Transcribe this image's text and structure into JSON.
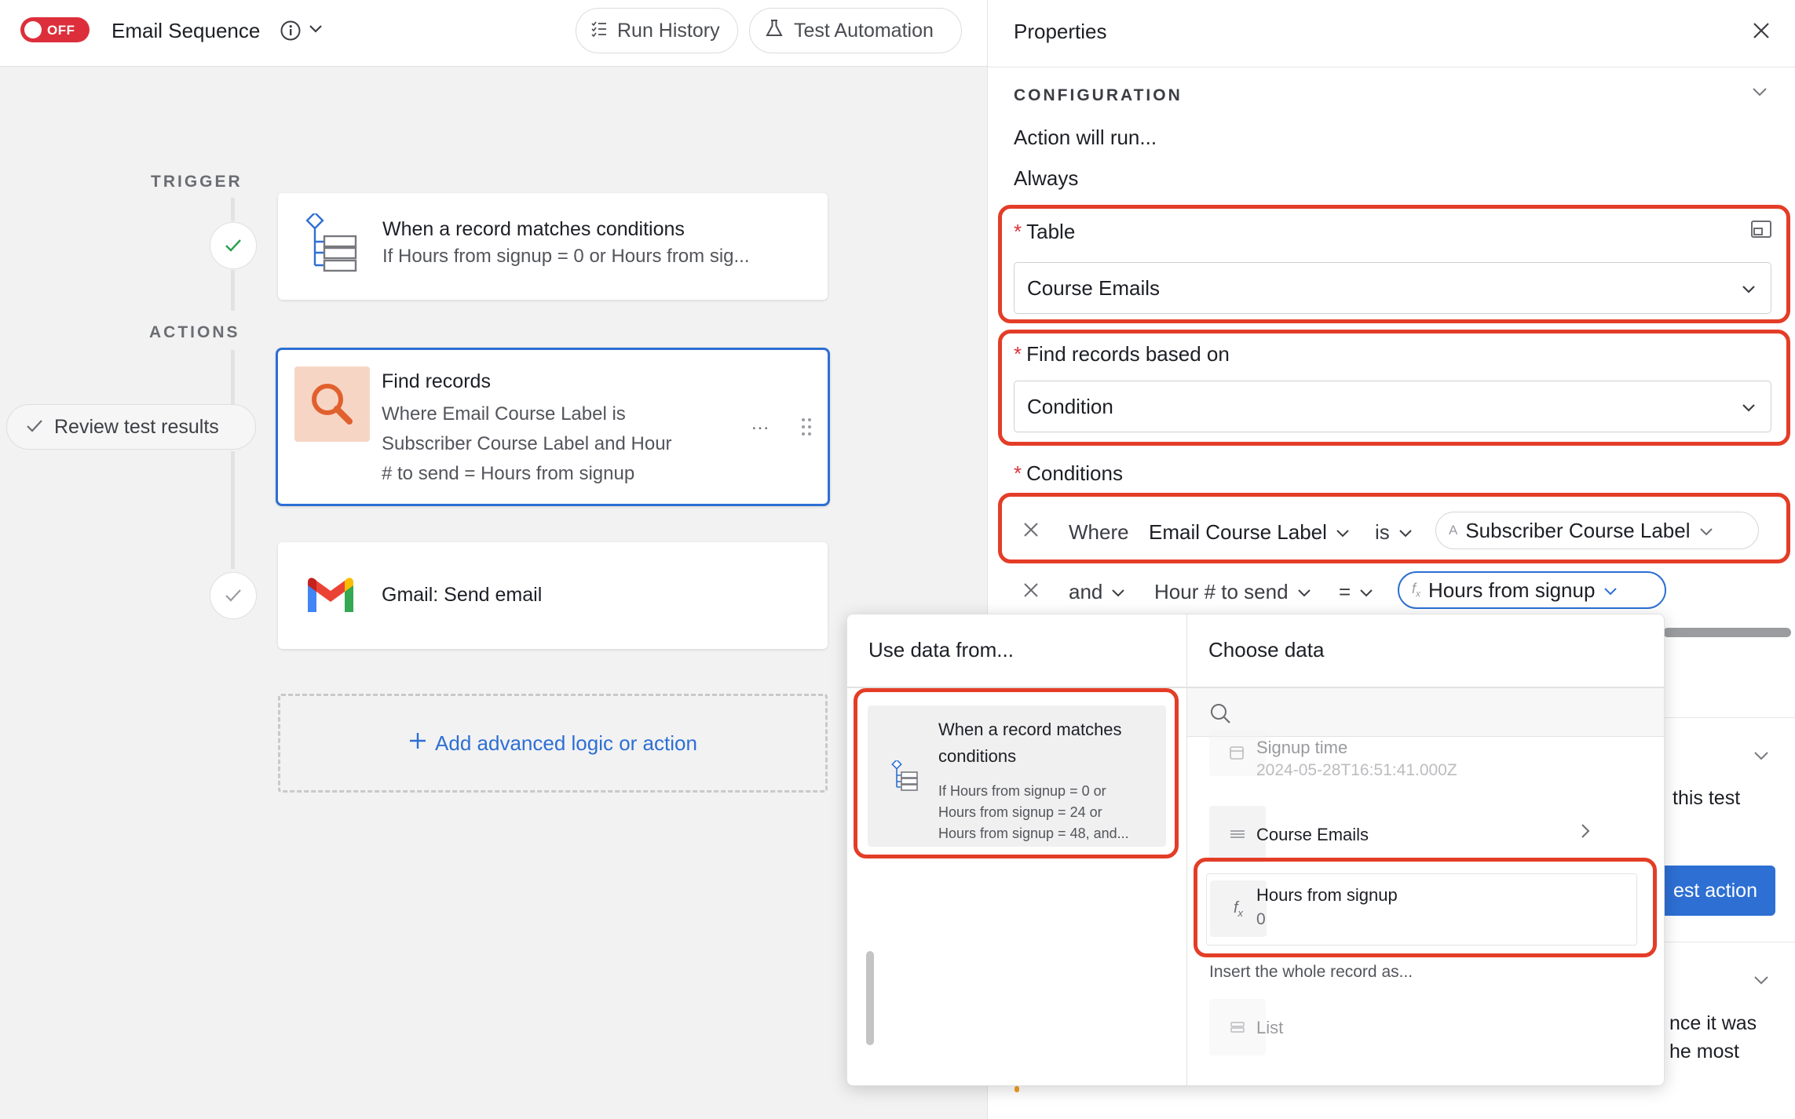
{
  "topbar": {
    "toggle_label": "OFF",
    "title": "Email Sequence",
    "run_history": "Run History",
    "test_automation": "Test Automation"
  },
  "canvas": {
    "trigger_label": "TRIGGER",
    "actions_label": "ACTIONS",
    "trigger_card": {
      "title": "When a record matches conditions",
      "subtitle": "If Hours from signup = 0 or Hours from sig..."
    },
    "find_card": {
      "title": "Find records",
      "line1": "Where Email Course Label is",
      "line2": "Subscriber Course Label and Hour",
      "line3": "# to send = Hours from signup",
      "more": "..."
    },
    "review_button": "Review test results",
    "gmail_card": {
      "title": "Gmail: Send email"
    },
    "add_logic": "Add advanced logic or action"
  },
  "properties": {
    "title": "Properties",
    "configuration": "CONFIGURATION",
    "action_will_run": "Action will run...",
    "run_mode": "Always",
    "table_label": "Table",
    "table_value": "Course Emails",
    "find_based_label": "Find records based on",
    "find_based_value": "Condition",
    "conditions_label": "Conditions",
    "cond1": {
      "prefix": "Where",
      "field": "Email Course Label",
      "op": "is",
      "value": "Subscriber Course Label"
    },
    "cond2": {
      "prefix": "and",
      "field": "Hour # to send",
      "op": "=",
      "value": "Hours from signup"
    },
    "peek_text_1": "this test",
    "peek_button": "est action",
    "peek_text_2": "nce it was",
    "peek_text_3": "he most"
  },
  "popover": {
    "left_heading": "Use data from...",
    "right_heading": "Choose data",
    "source": {
      "title": "When a record matches conditions",
      "sub1": "If Hours from signup = 0 or",
      "sub2": "Hours from signup = 24 or",
      "sub3": "Hours from signup = 48, and..."
    },
    "fields": [
      {
        "name": "Signup time",
        "value": "2024-05-28T16:51:41.000Z"
      },
      {
        "name": "Course Emails",
        "value": ""
      },
      {
        "name": "Hours from signup",
        "value": "0"
      }
    ],
    "insert_label": "Insert the whole record as...",
    "list_option": "List"
  },
  "colors": {
    "accent": "#2d6fd3",
    "highlight": "#e43d27",
    "toggle_off": "#dc2f3b"
  }
}
